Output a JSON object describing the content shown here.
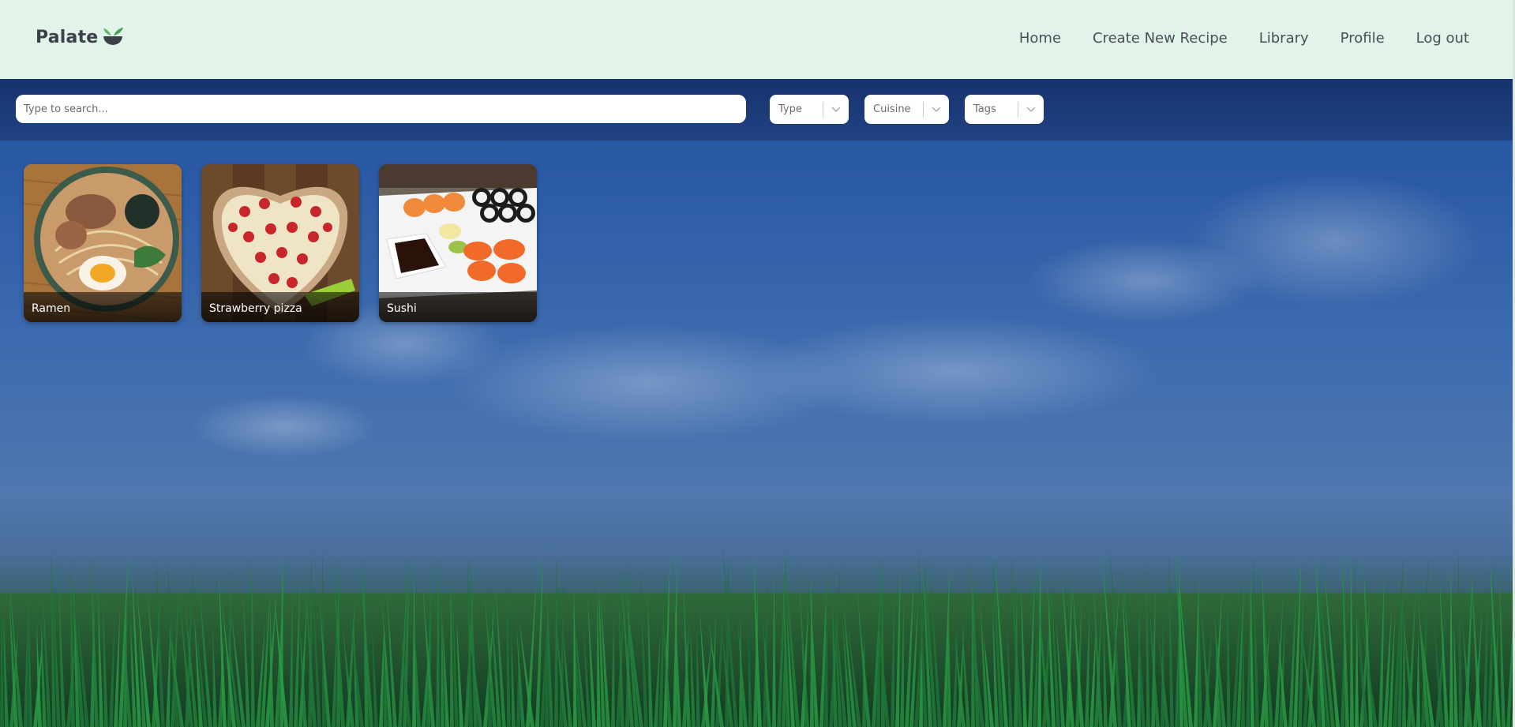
{
  "app": {
    "logo_text": "Palate",
    "logo_icon": "bowl-with-leaf-icon"
  },
  "nav": {
    "items": [
      {
        "label": "Home"
      },
      {
        "label": "Create New Recipe"
      },
      {
        "label": "Library"
      },
      {
        "label": "Profile"
      },
      {
        "label": "Log out"
      }
    ]
  },
  "filters": {
    "search": {
      "value": "",
      "placeholder": "Type to search..."
    },
    "type": {
      "placeholder": "Type",
      "icon": "chevron-down-icon"
    },
    "cuisine": {
      "placeholder": "Cuisine",
      "icon": "chevron-down-icon"
    },
    "tags": {
      "placeholder": "Tags",
      "icon": "chevron-down-icon"
    }
  },
  "recipes": [
    {
      "title": "Ramen"
    },
    {
      "title": "Strawberry pizza"
    },
    {
      "title": "Sushi"
    }
  ],
  "colors": {
    "header_bg": "#e2f4e9",
    "filter_bar_bg": "#1a3a7a",
    "logo_text": "#3d3f4a",
    "logo_leaf": "#5fb36b",
    "nav_text": "#4b4d57"
  }
}
